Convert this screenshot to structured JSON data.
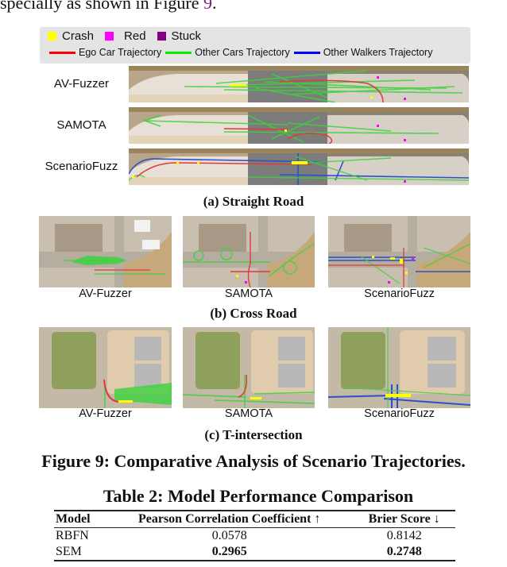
{
  "body_text": {
    "prefix": "specially as shown in Figure ",
    "figure_ref": "9",
    "suffix": "."
  },
  "legend": {
    "markers": [
      {
        "label": "Crash",
        "color": "#ffff00"
      },
      {
        "label": "Red",
        "color": "#ff00ff"
      },
      {
        "label": "Stuck",
        "color": "#800080"
      }
    ],
    "trajectories": [
      {
        "label": "Ego Car Trajectory",
        "color": "#ff0000"
      },
      {
        "label": "Other Cars Trajectory",
        "color": "#00ee00"
      },
      {
        "label": "Other Walkers Trajectory",
        "color": "#0000ff"
      }
    ]
  },
  "subfigures": {
    "straight_road": {
      "caption": "(a) Straight Road",
      "methods": [
        "AV-Fuzzer",
        "SAMOTA",
        "ScenarioFuzz"
      ]
    },
    "cross_road": {
      "caption": "(b) Cross Road",
      "methods": [
        "AV-Fuzzer",
        "SAMOTA",
        "ScenarioFuzz"
      ]
    },
    "t_intersection": {
      "caption": "(c) T-intersection",
      "methods": [
        "AV-Fuzzer",
        "SAMOTA",
        "ScenarioFuzz"
      ]
    }
  },
  "figure_caption": "Figure 9: Comparative Analysis of Scenario Trajectories.",
  "table": {
    "title": "Table 2: Model Performance Comparison",
    "headers": [
      "Model",
      "Pearson Correlation Coefficient ↑",
      "Brier Score ↓"
    ],
    "rows": [
      {
        "model": "RBFN",
        "pearson": "0.0578",
        "brier": "0.8142",
        "bold": false
      },
      {
        "model": "SEM",
        "pearson": "0.2965",
        "brier": "0.2748",
        "bold": true
      }
    ]
  }
}
